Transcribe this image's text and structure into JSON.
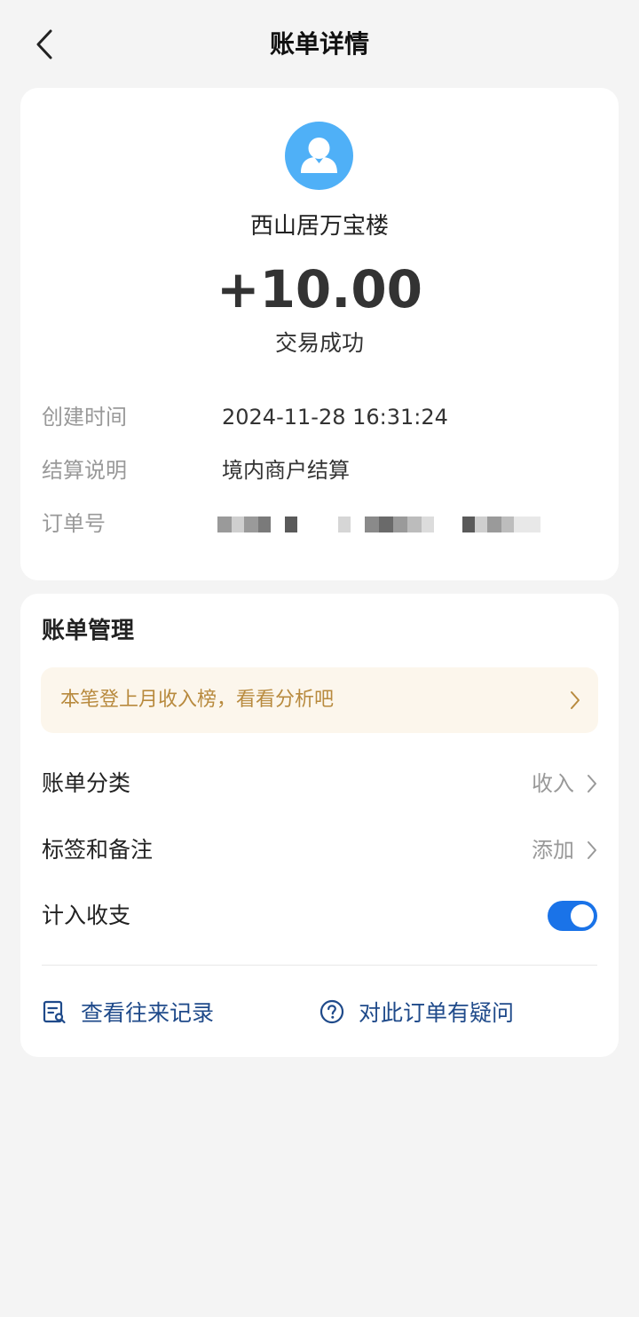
{
  "header": {
    "title": "账单详情"
  },
  "transaction": {
    "merchant": "西山居万宝楼",
    "amount": "+10.00",
    "status": "交易成功"
  },
  "details": {
    "created_label": "创建时间",
    "created_value": "2024-11-28 16:31:24",
    "settlement_label": "结算说明",
    "settlement_value": "境内商户结算",
    "order_label": "订单号"
  },
  "management": {
    "title": "账单管理",
    "banner": "本笔登上月收入榜，看看分析吧",
    "category_label": "账单分类",
    "category_value": "收入",
    "tags_label": "标签和备注",
    "tags_value": "添加",
    "include_label": "计入收支",
    "include_enabled": true
  },
  "links": {
    "history": "查看往来记录",
    "question": "对此订单有疑问"
  },
  "colors": {
    "accent": "#1a73e8",
    "avatar": "#4fb0f7",
    "banner_bg": "#fcf6ec",
    "banner_text": "#b88a3e",
    "link": "#1f4a8a"
  }
}
